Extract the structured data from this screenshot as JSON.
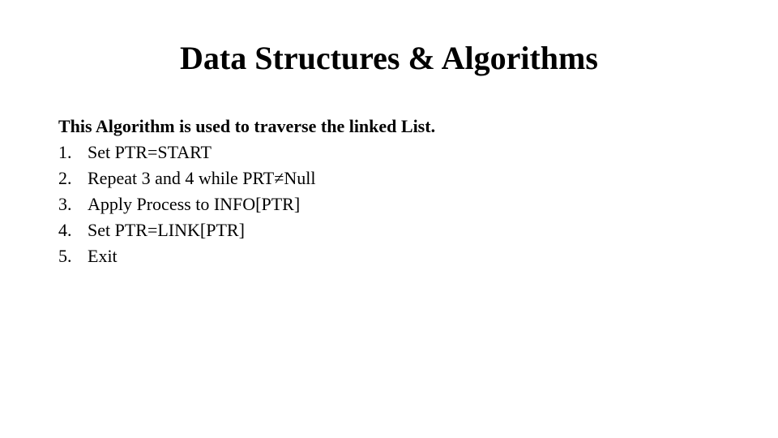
{
  "title": "Data Structures & Algorithms",
  "description": "This Algorithm is used to traverse the linked List.",
  "steps": [
    {
      "num": "1.",
      "text": "Set PTR=START"
    },
    {
      "num": "2.",
      "text": "Repeat 3 and 4 while PRT≠Null"
    },
    {
      "num": "3.",
      "text": "Apply Process to INFO[PTR]"
    },
    {
      "num": "4.",
      "text": "Set PTR=LINK[PTR]"
    },
    {
      "num": "5.",
      "text": "Exit"
    }
  ]
}
